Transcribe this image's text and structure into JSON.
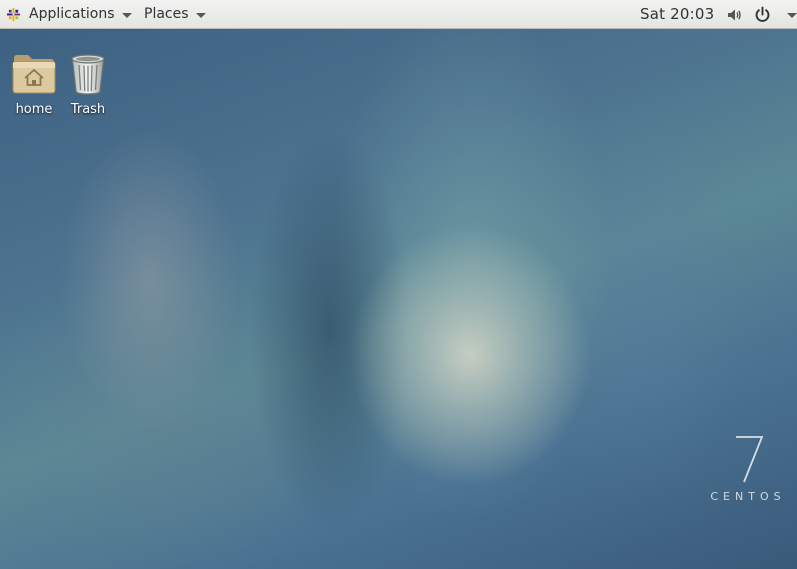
{
  "top_bar": {
    "applications_label": "Applications",
    "places_label": "Places",
    "clock": "Sat 20:03"
  },
  "icons": {
    "apps_logo": "centos-logo-icon",
    "volume": "speaker-volume-icon",
    "power": "power-icon",
    "dropdown": "chevron-down-icon"
  },
  "desktop": {
    "items": [
      {
        "label": "home",
        "icon": "home-folder-icon"
      },
      {
        "label": "Trash",
        "icon": "trash-icon"
      }
    ]
  },
  "watermark": {
    "version": "7",
    "word": "CENTOS"
  },
  "colors": {
    "top_bar": "#e9e9e7",
    "text": "#2e3436",
    "folder": "#d6c39a"
  }
}
